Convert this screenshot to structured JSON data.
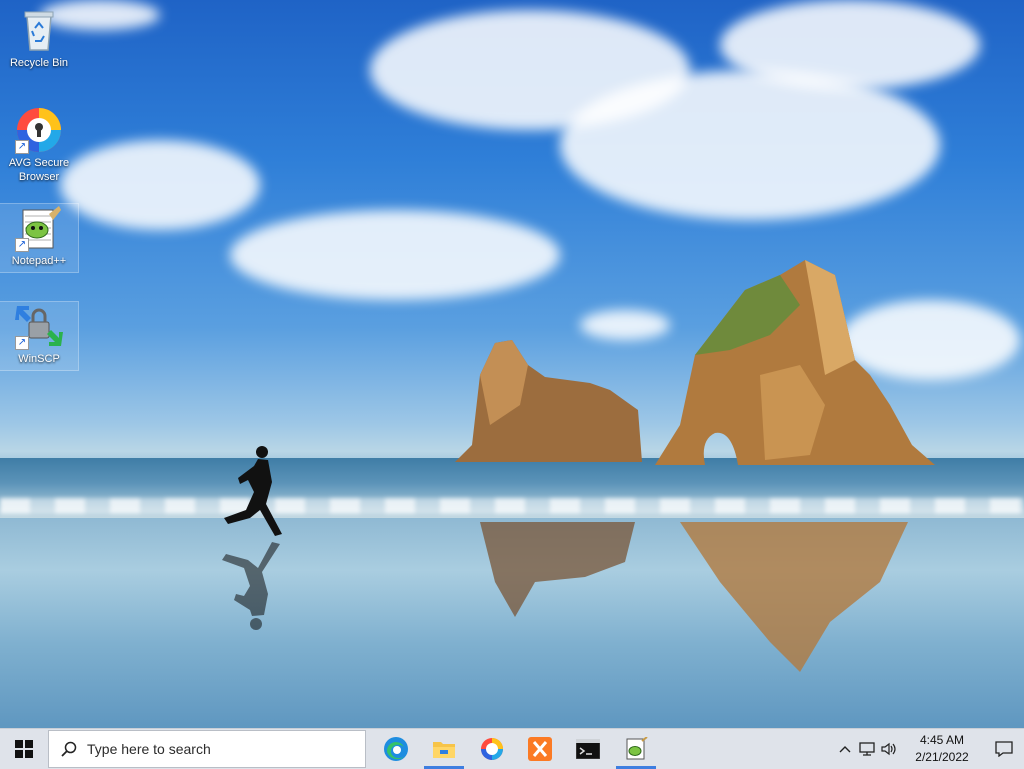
{
  "desktop": {
    "icons": [
      {
        "label": "Recycle Bin",
        "icon": "recycle-bin-icon"
      },
      {
        "label": "AVG Secure Browser",
        "icon": "avg-browser-icon"
      },
      {
        "label": "Notepad++",
        "icon": "notepad-plus-plus-icon"
      },
      {
        "label": "WinSCP",
        "icon": "winscp-icon"
      }
    ]
  },
  "taskbar": {
    "search_placeholder": "Type here to search",
    "apps": [
      {
        "name": "Microsoft Edge",
        "icon": "edge-icon",
        "running": false
      },
      {
        "name": "File Explorer",
        "icon": "file-explorer-icon",
        "running": true
      },
      {
        "name": "AVG Secure Browser",
        "icon": "avg-browser-icon",
        "running": false
      },
      {
        "name": "XAMPP",
        "icon": "xampp-icon",
        "running": false
      },
      {
        "name": "Command Prompt",
        "icon": "cmd-icon",
        "running": false
      },
      {
        "name": "Notepad++",
        "icon": "notepad-plus-plus-icon",
        "running": true
      }
    ],
    "tray": {
      "chevron": "^",
      "time": "4:45 AM",
      "date": "2/21/2022"
    }
  },
  "colors": {
    "taskbar_bg": "#dfe3ea",
    "running_indicator": "#3e7ee0",
    "sky_top": "#1f63c6"
  }
}
